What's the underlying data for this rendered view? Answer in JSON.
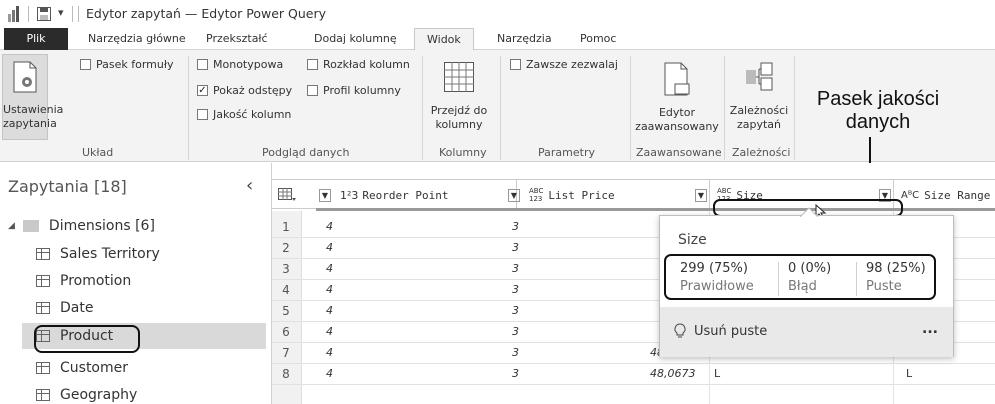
{
  "window": {
    "title": "Edytor zapytań — Edytor Power Query"
  },
  "tabs": [
    {
      "label": "Plik"
    },
    {
      "label": "Narzędzia główne"
    },
    {
      "label": "Przekształć"
    },
    {
      "label": "Dodaj kolumnę"
    },
    {
      "label": "Widok"
    },
    {
      "label": "Narzędzia"
    },
    {
      "label": "Pomoc"
    }
  ],
  "ribbon": {
    "layout": {
      "query_settings": "Ustawienia\nzapytania",
      "formula_bar": "Pasek formuły",
      "group": "Układ"
    },
    "preview": {
      "monospace": "Monotypowa",
      "show_whitespace": "Pokaż odstępy",
      "column_quality": "Jakość kolumn",
      "column_distribution": "Rozkład kolumn",
      "column_profile": "Profil kolumny",
      "group": "Podgląd danych"
    },
    "columns": {
      "go_to_column": "Przejdź do\nkolumny",
      "group": "Kolumny"
    },
    "parameters": {
      "always_allow": "Zawsze zezwalaj",
      "group": "Parametry"
    },
    "advanced": {
      "advanced_editor": "Edytor\nzaawansowany",
      "group": "Zaawansowane"
    },
    "dependencies": {
      "query_dependencies": "Zależności\nzapytań",
      "group": "Zależności"
    },
    "checked": {
      "monospace": false,
      "show_whitespace": true,
      "column_quality": false,
      "column_distribution": false,
      "column_profile": false,
      "formula_bar": false,
      "always_allow": false
    }
  },
  "annotation": "Pasek jakości\ndanych",
  "queries": {
    "title": "Zapytania [18]",
    "folder": "Dimensions [6]",
    "items": [
      {
        "label": "Sales Territory"
      },
      {
        "label": "Promotion"
      },
      {
        "label": "Date"
      },
      {
        "label": "Product"
      },
      {
        "label": "Customer"
      },
      {
        "label": "Geography"
      }
    ]
  },
  "grid": {
    "columns": [
      {
        "type": "1²3",
        "name": "Reorder Point"
      },
      {
        "type": "ABC\n123",
        "name": "List Price"
      },
      {
        "type": "ABC\n123",
        "name": "Size"
      },
      {
        "type": "AᴮC",
        "name": "Size Range"
      }
    ],
    "rows": [
      {
        "n": "1",
        "reorder": "4",
        "list": "3",
        "price": "",
        "size": "",
        "range": ""
      },
      {
        "n": "2",
        "reorder": "4",
        "list": "3",
        "price": "",
        "size": "",
        "range": ""
      },
      {
        "n": "3",
        "reorder": "4",
        "list": "3",
        "price": "",
        "size": "",
        "range": ""
      },
      {
        "n": "4",
        "reorder": "4",
        "list": "3",
        "price": "",
        "size": "",
        "range": ""
      },
      {
        "n": "5",
        "reorder": "4",
        "list": "3",
        "price": "",
        "size": "",
        "range": ""
      },
      {
        "n": "6",
        "reorder": "4",
        "list": "3",
        "price": "",
        "size": "",
        "range": ""
      },
      {
        "n": "7",
        "reorder": "4",
        "list": "3",
        "price": "48,0673",
        "size": "L",
        "range": "L"
      },
      {
        "n": "8",
        "reorder": "4",
        "list": "3",
        "price": "48,0673",
        "size": "L",
        "range": "L"
      }
    ]
  },
  "popup": {
    "title": "Size",
    "valid_value": "299 (75%)",
    "valid_label": "Prawidłowe",
    "error_value": "0 (0%)",
    "error_label": "Błąd",
    "empty_value": "98 (25%)",
    "empty_label": "Puste",
    "action": "Usuń puste",
    "more": "..."
  }
}
